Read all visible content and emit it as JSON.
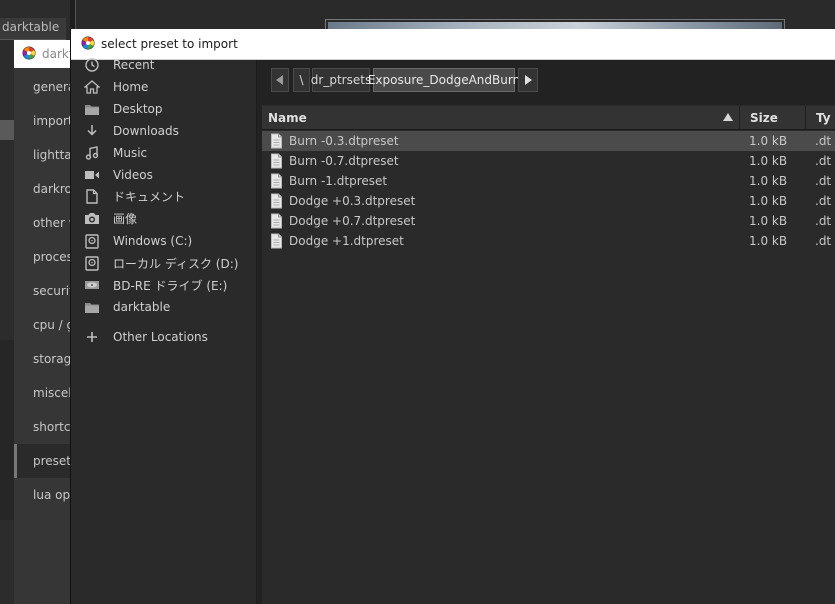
{
  "background": {
    "tab_label": "darktable",
    "prefs_items": [
      "general",
      "import",
      "lighttable",
      "darkroom",
      "other views",
      "processing",
      "security",
      "cpu / gpu / memory",
      "storage",
      "miscellaneous",
      "shortcuts",
      "presets",
      "lua options"
    ]
  },
  "dialog": {
    "title": "select preset to import",
    "places": [
      {
        "label": "Recent",
        "icon": "clock-icon"
      },
      {
        "label": "Home",
        "icon": "home-icon"
      },
      {
        "label": "Desktop",
        "icon": "folder-icon"
      },
      {
        "label": "Downloads",
        "icon": "download-icon"
      },
      {
        "label": "Music",
        "icon": "music-icon"
      },
      {
        "label": "Videos",
        "icon": "video-icon"
      },
      {
        "label": "ドキュメント",
        "icon": "document-icon"
      },
      {
        "label": "画像",
        "icon": "camera-icon"
      },
      {
        "label": "Windows (C:)",
        "icon": "drive-icon"
      },
      {
        "label": "ローカル ディスク (D:)",
        "icon": "drive-icon"
      },
      {
        "label": "BD-RE ドライブ (E:)",
        "icon": "optical-drive-icon"
      },
      {
        "label": "darktable",
        "icon": "folder-icon"
      },
      {
        "label": "Other Locations",
        "icon": "plus-icon"
      }
    ],
    "path": {
      "root": "\\",
      "segments": [
        "dr_ptrsets",
        "Exposure_DodgeAndBurn"
      ],
      "current_index": 1
    },
    "columns": {
      "name": "Name",
      "size": "Size",
      "type": "Ty"
    },
    "files": [
      {
        "name": "Burn -0.3.dtpreset",
        "size": "1.0 kB",
        "type": ".dt",
        "selected": true
      },
      {
        "name": "Burn -0.7.dtpreset",
        "size": "1.0 kB",
        "type": ".dt",
        "selected": false
      },
      {
        "name": "Burn -1.dtpreset",
        "size": "1.0 kB",
        "type": ".dt",
        "selected": false
      },
      {
        "name": "Dodge +0.3.dtpreset",
        "size": "1.0 kB",
        "type": ".dt",
        "selected": false
      },
      {
        "name": "Dodge +0.7.dtpreset",
        "size": "1.0 kB",
        "type": ".dt",
        "selected": false
      },
      {
        "name": "Dodge +1.dtpreset",
        "size": "1.0 kB",
        "type": ".dt",
        "selected": false
      }
    ]
  },
  "colors": {
    "selected_row": "#4b4b4b",
    "title_bg": "#ffffff"
  }
}
